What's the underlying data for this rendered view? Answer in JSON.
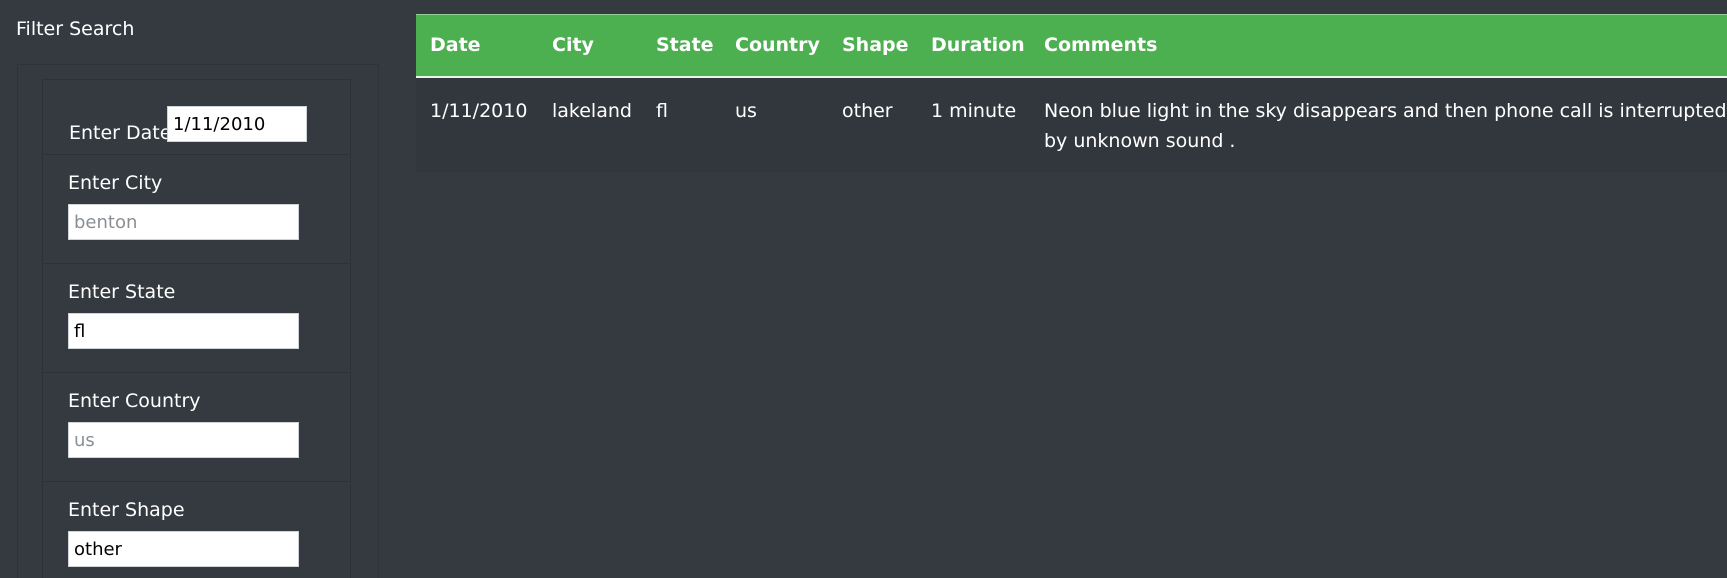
{
  "sidebar": {
    "title": "Filter Search",
    "filters": [
      {
        "label": "Enter Date",
        "value": "1/11/2010",
        "placeholder": ""
      },
      {
        "label": "Enter City",
        "value": "",
        "placeholder": "benton"
      },
      {
        "label": "Enter State",
        "value": "fl",
        "placeholder": ""
      },
      {
        "label": "Enter Country",
        "value": "",
        "placeholder": "us"
      },
      {
        "label": "Enter Shape",
        "value": "other",
        "placeholder": ""
      }
    ]
  },
  "table": {
    "columns": [
      "Date",
      "City",
      "State",
      "Country",
      "Shape",
      "Duration",
      "Comments"
    ],
    "rows": [
      [
        "1/11/2010",
        "lakeland",
        "fl",
        "us",
        "other",
        "1 minute",
        "Neon blue light in the sky disappears and then phone call is interrupted by unknown sound ."
      ]
    ]
  },
  "colors": {
    "background": "#343a40",
    "header": "#4caf50",
    "row": "#32373d",
    "text": "#ffffff"
  }
}
